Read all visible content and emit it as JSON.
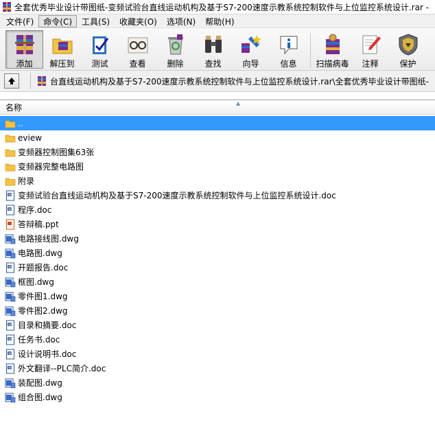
{
  "window": {
    "title": "全套优秀毕业设计带图纸-变频试验台直线运动机构及基于S7-200速度示教系统控制软件与上位监控系统设计.rar -"
  },
  "menu": [
    {
      "label": "文件(F)"
    },
    {
      "label": "命令(C)"
    },
    {
      "label": "工具(S)"
    },
    {
      "label": "收藏夹(O)"
    },
    {
      "label": "选项(N)"
    },
    {
      "label": "帮助(H)"
    }
  ],
  "toolbar": {
    "add": "添加",
    "extract": "解压到",
    "test": "测试",
    "view": "查看",
    "delete": "删除",
    "find": "查找",
    "wizard": "向导",
    "info": "信息",
    "virus_scan": "扫描病毒",
    "comment": "注释",
    "protect": "保护"
  },
  "address": {
    "path": "台直线运动机构及基于S7-200速度示教系统控制软件与上位监控系统设计.rar\\全套优秀毕业设计带图纸-"
  },
  "list": {
    "column_name": "名称",
    "rows": [
      {
        "name": "..",
        "type": "folder"
      },
      {
        "name": "eview",
        "type": "folder"
      },
      {
        "name": "变频器控制图集63张",
        "type": "folder"
      },
      {
        "name": "变频器完整电路图",
        "type": "folder"
      },
      {
        "name": "附录",
        "type": "folder"
      },
      {
        "name": "变频试验台直线运动机构及基于S7-200速度示教系统控制软件与上位监控系统设计.doc",
        "type": "doc"
      },
      {
        "name": "程序.doc",
        "type": "doc"
      },
      {
        "name": "答辩稿.ppt",
        "type": "ppt"
      },
      {
        "name": "电路接线图.dwg",
        "type": "dwg"
      },
      {
        "name": "电路图.dwg",
        "type": "dwg"
      },
      {
        "name": "开题报告.doc",
        "type": "doc"
      },
      {
        "name": "框图.dwg",
        "type": "dwg"
      },
      {
        "name": "零件图1.dwg",
        "type": "dwg"
      },
      {
        "name": "零件图2.dwg",
        "type": "dwg"
      },
      {
        "name": "目录和摘要.doc",
        "type": "doc"
      },
      {
        "name": "任务书.doc",
        "type": "doc"
      },
      {
        "name": "设计说明书.doc",
        "type": "doc"
      },
      {
        "name": "外文翻译--PLC简介.doc",
        "type": "doc"
      },
      {
        "name": "装配图.dwg",
        "type": "dwg"
      },
      {
        "name": "组合图.dwg",
        "type": "dwg"
      }
    ]
  },
  "colors": {
    "selection": "#3399ff",
    "folder": "#f5c242",
    "doc": "#2b5797"
  }
}
